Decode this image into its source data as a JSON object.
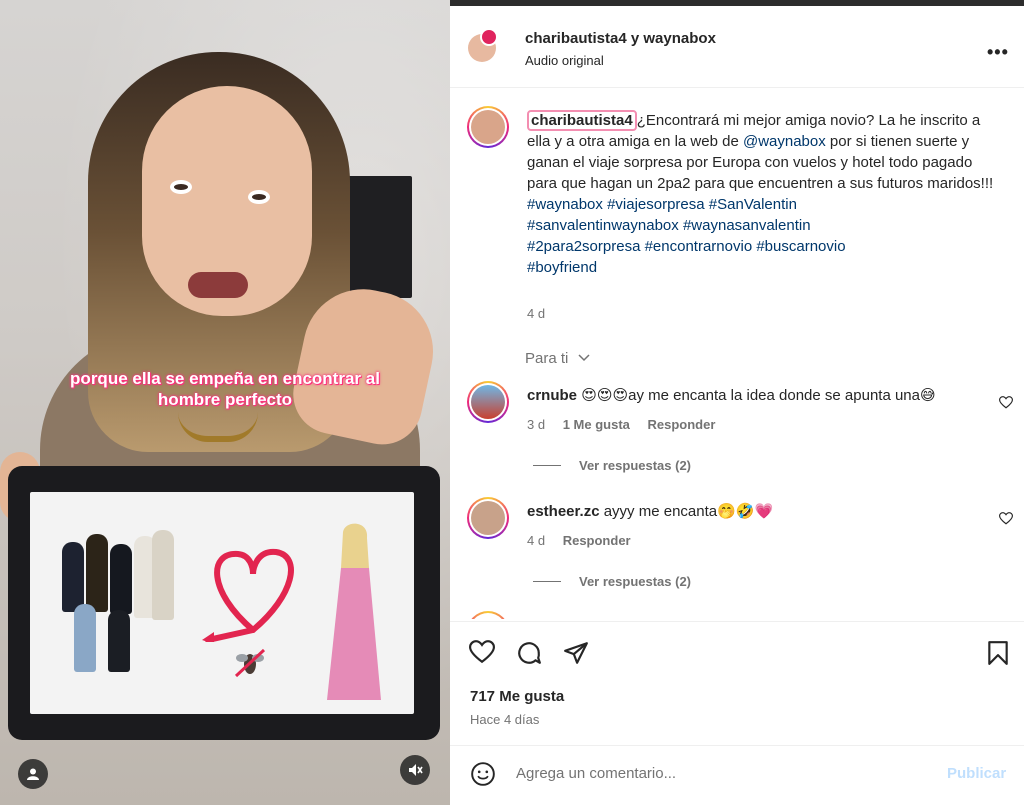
{
  "video": {
    "caption": "porque ella se empeña en encontrar al hombre perfecto"
  },
  "header": {
    "names": "charibautista4 y waynabox",
    "audio": "Audio original",
    "more_label": "•••"
  },
  "post": {
    "username": "charibautista4",
    "text": "¿Encontrará mi mejor amiga novio? La he inscrito a ella y a otra amiga en la web de ",
    "mention": "@waynabox",
    "text2": " por si tienen suerte y ganan el viaje sorpresa por Europa con vuelos y hotel todo pagado para que hagan un 2pa2 para que encuentren a sus futuros maridos!!!",
    "hashtags": [
      "#waynabox",
      "#viajesorpresa",
      "#SanValentin",
      "#sanvalentinwaynabox",
      "#waynasanvalentin",
      "#2para2sorpresa",
      "#encontrarnovio",
      "#buscarnovio",
      "#boyfriend"
    ],
    "time": "4 d"
  },
  "para_ti": "Para ti",
  "comments": [
    {
      "user": "crnube",
      "text": "😍😍😍ay me encanta la idea donde se apunta una😅",
      "time": "3 d",
      "likes": "1 Me gusta",
      "reply": "Responder",
      "view_replies": "Ver respuestas (2)"
    },
    {
      "user": "estheer.zc",
      "text": "ayyy me encanta🤭🤣💗",
      "time": "4 d",
      "reply": "Responder",
      "view_replies": "Ver respuestas (2)"
    }
  ],
  "footer": {
    "likes": "717 Me gusta",
    "ago": "Hace 4 días",
    "comment_placeholder": "Agrega un comentario...",
    "publish": "Publicar"
  },
  "colors": {
    "link": "#00376b",
    "muted": "#737373",
    "publish_disabled": "#c0dffd",
    "caption_glow": "#ff2e7e"
  }
}
